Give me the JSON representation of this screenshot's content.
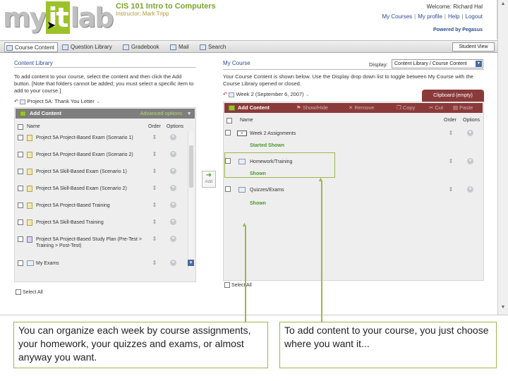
{
  "header": {
    "logo_pre": "my",
    "logo_it": "it",
    "logo_post": "lab",
    "course_title": "CIS 101 Intro to Computers",
    "instructor": "Instructor: Mark Tripp",
    "welcome": "Welcome: Richard Hal",
    "links": [
      "My Courses",
      "My profile",
      "Help",
      "Logout"
    ],
    "powered_by": "Powered by Pegasus"
  },
  "nav": {
    "tabs": [
      "Course Content",
      "Question Library",
      "Gradebook",
      "Mail",
      "Search"
    ],
    "student_view": "Student View"
  },
  "content_library": {
    "title": "Content Library",
    "instructions": "To add content to your course, select the content and then click the Add button. [Note that folders cannot be added; you must select a specific item to add to your course.]",
    "breadcrumb": "Project 5A: Thank You Letter",
    "add_label": "Add Content",
    "advanced_label": "Advanced options",
    "col_name": "Name",
    "col_order": "Order",
    "col_options": "Options",
    "items": [
      "Project 5A Project-Based Exam (Scenario 1)",
      "Project 5A Project-Based Exam (Scenario 2)",
      "Project 5A Skill-Based Exam (Scenario 1)",
      "Project 5A Skill-Based Exam (Scenario 2)",
      "Project 5A Project-Based Training",
      "Project 5A Skill-Based Training",
      "Project 5A Project-Based Study Plan (Pre-Test > Training > Post-Test)",
      "My Exams"
    ],
    "select_all": "Select All"
  },
  "add_button": {
    "label": "Add"
  },
  "my_course": {
    "title": "My Course",
    "display_label": "Display:",
    "display_value": "Content Library / Course Content",
    "instructions": "Your Course Content is shown below. Use the Display drop down list to toggle between My Course with the Course Library opened or closed.",
    "breadcrumb": "Week 2 (September 6, 2007)",
    "clipboard": "Clipboard (empty)",
    "toolbar": {
      "add": "Add Content",
      "showhide": "Show/Hide",
      "remove": "Remove",
      "copy": "Copy",
      "cut": "Cut",
      "paste": "Paste"
    },
    "col_name": "Name",
    "col_order": "Order",
    "col_options": "Options",
    "items": [
      {
        "name": "Week 2 Assignments",
        "status": "Started   Shown"
      },
      {
        "name": "Homework/Training",
        "status": "Shown"
      },
      {
        "name": "Quizzes/Exams",
        "status": "Shown"
      }
    ],
    "select_all": "Select All"
  },
  "annotations": {
    "left": "You can organize each week by course assignments, your homework, your quizzes and exams, or almost anyway you want.",
    "right": "To add content to your course, you just choose where you want it..."
  },
  "colors": {
    "accent_green": "#9cb74a",
    "toolbar_maroon": "#8b3a3a",
    "link_blue": "#2a4d8f"
  }
}
